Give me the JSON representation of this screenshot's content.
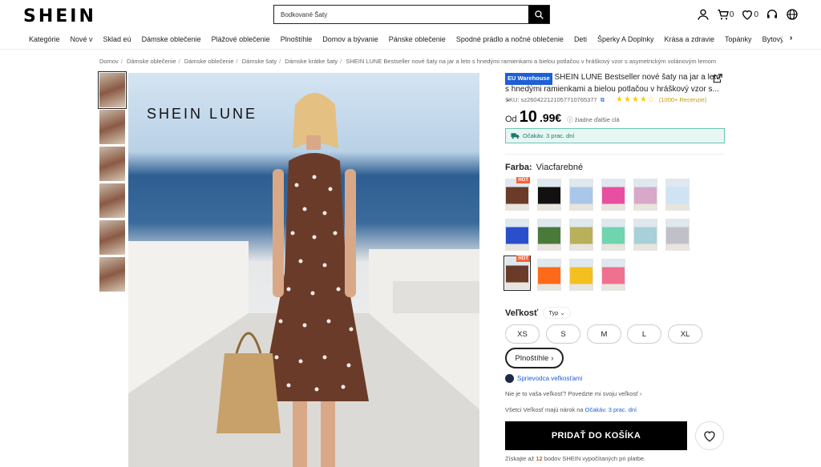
{
  "header": {
    "logo": "SHEIN",
    "search_value": "Bodkované Šaty",
    "cart_count": "0",
    "wishlist_count": "0"
  },
  "nav": {
    "items": [
      "Kategórie",
      "Nové v",
      "Sklad eú",
      "Dámske oblečenie",
      "Plážové oblečenie",
      "Plnoštíhle",
      "Domov a bývanie",
      "Pánske oblečenie",
      "Spodné prádlo a nočné oblečenie",
      "Deti",
      "Šperky A Doplnky",
      "Krása a zdravie",
      "Topánky",
      "Bytový T"
    ]
  },
  "breadcrumb": {
    "items": [
      "Domov",
      "Dámske oblečenie",
      "Dámske oblečenie",
      "Dámske šaty",
      "Dámske krátke šaty"
    ],
    "current": "SHEIN LUNE Bestseller nové šaty na jar a leto s hnedými ramienkami a bielou potlačou v hráškový vzor s asymetrickým volánovým lemom"
  },
  "gallery": {
    "brand_overlay": "SHEIN LUNE",
    "thumb_count": 6,
    "image_colors": {
      "dress": "#6b3b2a",
      "dots": "#ffffff",
      "sea": "#2f5f92"
    }
  },
  "product": {
    "warehouse_badge": "EU Warehouse",
    "title": "SHEIN LUNE Bestseller nové šaty na jar a leto s hnedými ramienkami a bielou potlačou v hráškový vzor s...",
    "sku_label": "SKU: sz2604221210577107653​77",
    "rating": 4.5,
    "reviews": "(1000+ Recenzie)",
    "price_from": "Od",
    "price_main": "10",
    "price_cents": ".99€",
    "price_note": "žiadne ďalšie clá",
    "delivery": "Očakáv. 3 prac. dní",
    "color_label": "Farba:",
    "color_value": "Viacfarebné",
    "hot_label": "HOT",
    "size_label": "Veľkosť",
    "size_type": "Typ",
    "sizes": [
      "XS",
      "S",
      "M",
      "L",
      "XL"
    ],
    "plus_size": "Plnoštíhle",
    "size_guide": "Sprievodca veľkosťami",
    "fit_question": "Nie je to vaša veľkosť? Povedzte mi svoju veľkosť",
    "all_sizes_prefix": "Všetci Veľkosť majú nárok na",
    "all_sizes_link": "Očakáv. 3 prac. dní",
    "add_to_cart": "PRIDAŤ DO KOŠÍKA",
    "points_prefix": "Získajte až",
    "points_value": "12",
    "points_suffix": "bodov SHEIN vypočítaných pri platbe."
  },
  "swatch_colors": [
    "#6b3b2a",
    "#111111",
    "#a9c7e8",
    "#e84fa0",
    "#d8a8c8",
    "#cfe3f5",
    "#2a4fcc",
    "#4a7a3a",
    "#b8b05a",
    "#6fd4b0",
    "#a8d0d8",
    "#c0c0c8",
    "#6b3b2a",
    "#ff6a1a",
    "#f4c020",
    "#f07090"
  ]
}
